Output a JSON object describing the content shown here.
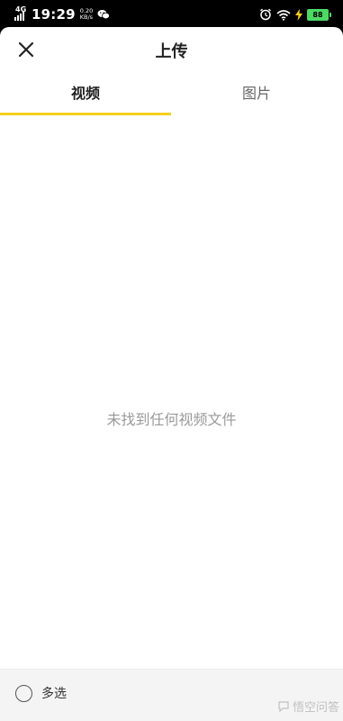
{
  "status_bar": {
    "network": "4G",
    "time": "19:29",
    "speed_value": "0.20",
    "speed_unit": "KB/s",
    "battery": "88"
  },
  "header": {
    "title": "上传"
  },
  "tabs": [
    {
      "label": "视频",
      "active": true
    },
    {
      "label": "图片",
      "active": false
    }
  ],
  "content": {
    "empty_message": "未找到任何视频文件"
  },
  "footer": {
    "multi_select_label": "多选"
  },
  "watermark": {
    "text": "悟空问答"
  },
  "colors": {
    "accent": "#f7d01c",
    "battery": "#4cd964",
    "muted_text": "#9a9a9a"
  }
}
